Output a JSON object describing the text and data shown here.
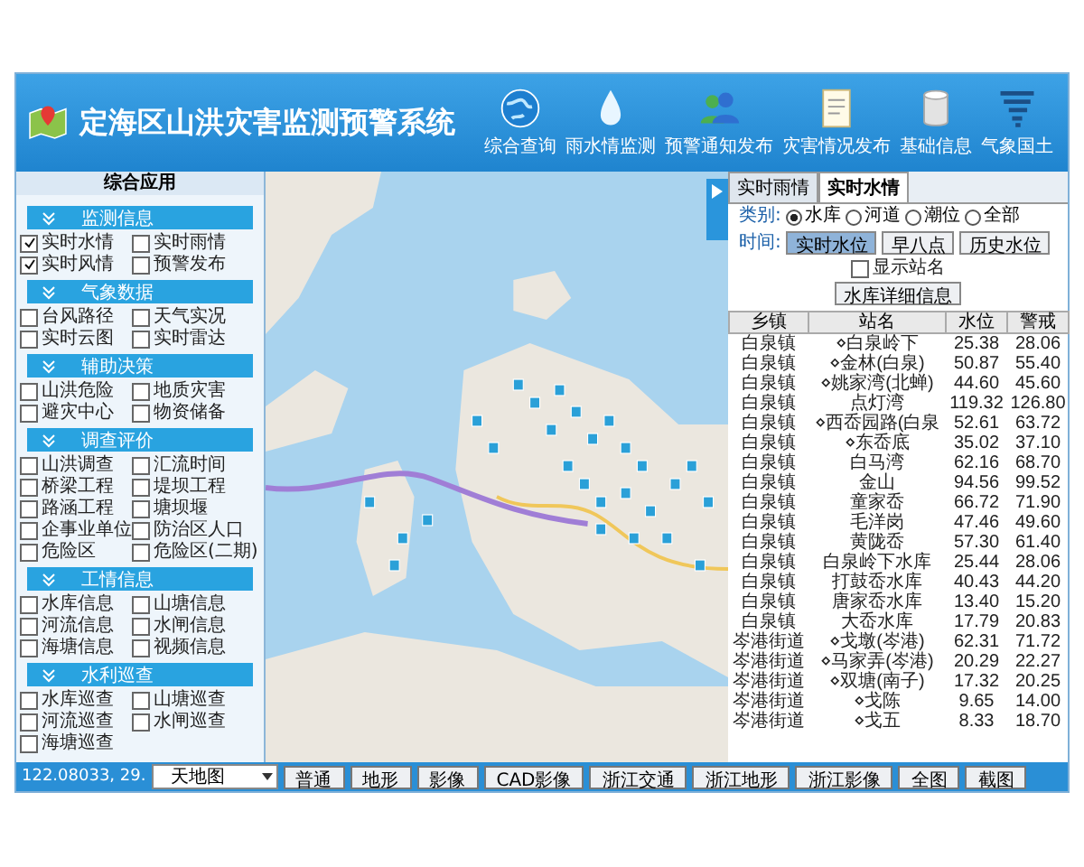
{
  "header": {
    "title": "定海区山洪灾害监测预警系统",
    "nav": [
      "综合查询",
      "雨水情监测",
      "预警通知发布",
      "灾害情况发布",
      "基础信息",
      "气象国土"
    ]
  },
  "sidebar": {
    "title": "综合应用",
    "sections": [
      {
        "title": "监测信息",
        "items": [
          {
            "label": "实时水情",
            "checked": true
          },
          {
            "label": "实时雨情",
            "checked": false
          },
          {
            "label": "实时风情",
            "checked": true
          },
          {
            "label": "预警发布",
            "checked": false
          }
        ]
      },
      {
        "title": "气象数据",
        "items": [
          {
            "label": "台风路径",
            "checked": false
          },
          {
            "label": "天气实况",
            "checked": false
          },
          {
            "label": "实时云图",
            "checked": false
          },
          {
            "label": "实时雷达",
            "checked": false
          }
        ]
      },
      {
        "title": "辅助决策",
        "items": [
          {
            "label": "山洪危险",
            "checked": false
          },
          {
            "label": "地质灾害",
            "checked": false
          },
          {
            "label": "避灾中心",
            "checked": false
          },
          {
            "label": "物资储备",
            "checked": false
          }
        ]
      },
      {
        "title": "调查评价",
        "items": [
          {
            "label": "山洪调查",
            "checked": false
          },
          {
            "label": "汇流时间",
            "checked": false
          },
          {
            "label": "桥梁工程",
            "checked": false
          },
          {
            "label": "堤坝工程",
            "checked": false
          },
          {
            "label": "路涵工程",
            "checked": false
          },
          {
            "label": "塘坝堰",
            "checked": false
          },
          {
            "label": "企事业单位",
            "checked": false
          },
          {
            "label": "防治区人口",
            "checked": false
          },
          {
            "label": "危险区",
            "checked": false
          },
          {
            "label": "危险区(二期)",
            "checked": false
          }
        ]
      },
      {
        "title": "工情信息",
        "items": [
          {
            "label": "水库信息",
            "checked": false
          },
          {
            "label": "山塘信息",
            "checked": false
          },
          {
            "label": "河流信息",
            "checked": false
          },
          {
            "label": "水闸信息",
            "checked": false
          },
          {
            "label": "海塘信息",
            "checked": false
          },
          {
            "label": "视频信息",
            "checked": false
          }
        ]
      },
      {
        "title": "水利巡查",
        "items": [
          {
            "label": "水库巡查",
            "checked": false
          },
          {
            "label": "山塘巡查",
            "checked": false
          },
          {
            "label": "河流巡查",
            "checked": false
          },
          {
            "label": "水闸巡查",
            "checked": false
          },
          {
            "label": "海塘巡查",
            "checked": false
          }
        ]
      }
    ]
  },
  "panel": {
    "tabs": [
      {
        "label": "实时雨情",
        "selected": false
      },
      {
        "label": "实时水情",
        "selected": true
      }
    ],
    "category_label": "类别:",
    "categories": [
      {
        "label": "水库",
        "selected": true
      },
      {
        "label": "河道",
        "selected": false
      },
      {
        "label": "潮位",
        "selected": false
      },
      {
        "label": "全部",
        "selected": false
      }
    ],
    "time_label": "时间:",
    "time_buttons": [
      {
        "label": "实时水位",
        "selected": true
      },
      {
        "label": "早八点",
        "selected": false
      },
      {
        "label": "历史水位",
        "selected": false
      }
    ],
    "show_names": {
      "label": "显示站名",
      "checked": false
    },
    "detail_button": "水库详细信息",
    "table": {
      "columns": [
        "乡镇",
        "站名",
        "水位",
        "警戒"
      ],
      "rows": [
        [
          "白泉镇",
          "⋄白泉岭下",
          "25.38",
          "28.06"
        ],
        [
          "白泉镇",
          "⋄金林(白泉)",
          "50.87",
          "55.40"
        ],
        [
          "白泉镇",
          "⋄姚家湾(北蝉)",
          "44.60",
          "45.60"
        ],
        [
          "白泉镇",
          "点灯湾",
          "119.32",
          "126.80"
        ],
        [
          "白泉镇",
          "⋄西岙园路(白泉",
          "52.61",
          "63.72"
        ],
        [
          "白泉镇",
          "⋄东岙底",
          "35.02",
          "37.10"
        ],
        [
          "白泉镇",
          "白马湾",
          "62.16",
          "68.70"
        ],
        [
          "白泉镇",
          "金山",
          "94.56",
          "99.52"
        ],
        [
          "白泉镇",
          "童家岙",
          "66.72",
          "71.90"
        ],
        [
          "白泉镇",
          "毛洋岗",
          "47.46",
          "49.60"
        ],
        [
          "白泉镇",
          "黄陇岙",
          "57.30",
          "61.40"
        ],
        [
          "白泉镇",
          "白泉岭下水库",
          "25.44",
          "28.06"
        ],
        [
          "白泉镇",
          "打鼓岙水库",
          "40.43",
          "44.20"
        ],
        [
          "白泉镇",
          "唐家岙水库",
          "13.40",
          "15.20"
        ],
        [
          "白泉镇",
          "大岙水库",
          "17.79",
          "20.83"
        ],
        [
          "岑港街道",
          "⋄戈墩(岑港)",
          "62.31",
          "71.72"
        ],
        [
          "岑港街道",
          "⋄马家弄(岑港)",
          "20.29",
          "22.27"
        ],
        [
          "岑港街道",
          "⋄双塘(南子)",
          "17.32",
          "20.25"
        ],
        [
          "岑港街道",
          "⋄戈陈",
          "9.65",
          "14.00"
        ],
        [
          "岑港街道",
          "⋄戈五",
          "8.33",
          "18.70"
        ]
      ]
    }
  },
  "bottom_bar": {
    "coordinates": "122.08033, 29.",
    "map_select": "天地图",
    "buttons": [
      "普通",
      "地形",
      "影像",
      "CAD影像",
      "浙江交通",
      "浙江地形",
      "浙江影像",
      "全图",
      "截图"
    ]
  }
}
